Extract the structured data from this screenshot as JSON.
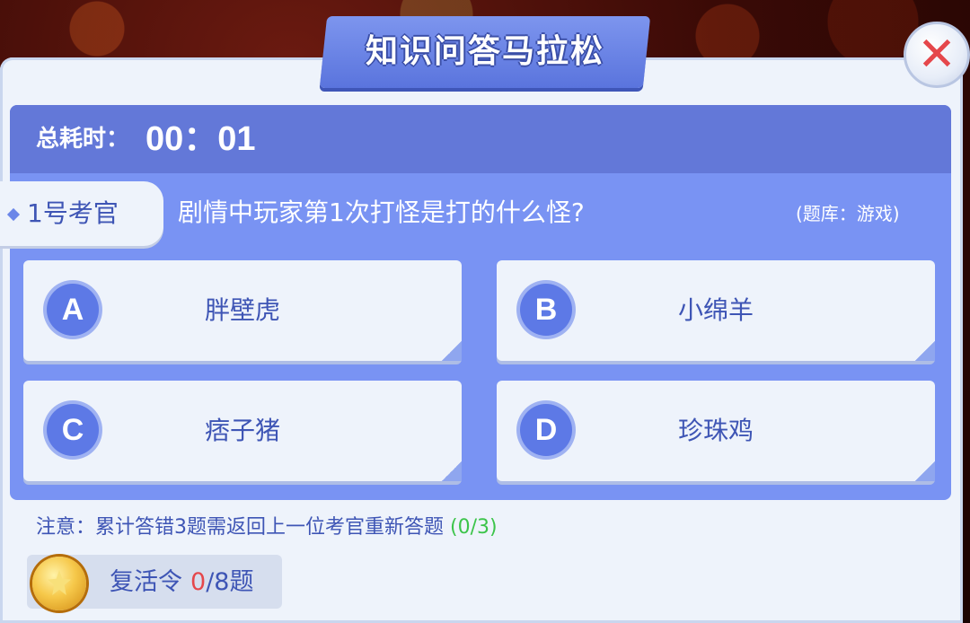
{
  "title": "知识问答马拉松",
  "timer": {
    "label": "总耗时：",
    "value": "00：01"
  },
  "examiner": "1号考官",
  "question": "剧情中玩家第1次打怪是打的什么怪?",
  "bank": "(题库：游戏)",
  "options": [
    {
      "letter": "A",
      "text": "胖壁虎"
    },
    {
      "letter": "B",
      "text": "小绵羊"
    },
    {
      "letter": "C",
      "text": "痞子猪"
    },
    {
      "letter": "D",
      "text": "珍珠鸡"
    }
  ],
  "notice": {
    "text": "注意：累计答错3题需返回上一位考官重新答题",
    "count": "(0/3)"
  },
  "revive": {
    "label": "复活令",
    "used": "0",
    "total": "/8题"
  },
  "icons": {
    "close": "close-icon",
    "coin": "revive-coin-icon"
  },
  "colors": {
    "primary": "#7993f3",
    "header": "#6378d8",
    "text": "#3e55b5",
    "close": "#e5474b",
    "success": "#3cc44a"
  }
}
